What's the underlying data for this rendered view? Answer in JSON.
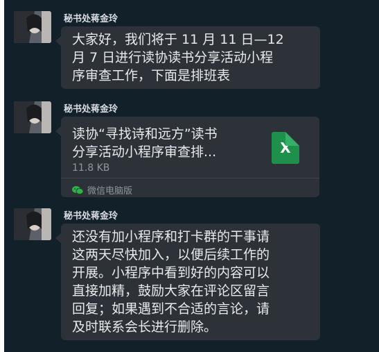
{
  "messages": [
    {
      "sender": "秘书处蒋金玲",
      "type": "text",
      "lines": [
        "大家好，我们将于 11 月 11 日—12",
        "月 7 日进行读协读书分享活动小程",
        "序审查工作，下面是排班表"
      ]
    },
    {
      "sender": "秘书处蒋金玲",
      "type": "file",
      "file_name_lines": [
        "读协“寻找诗和远方”读书",
        "分享活动小程序审查排..."
      ],
      "file_size": "11.8 KB",
      "file_icon_letter": "X",
      "source": "微信电脑版",
      "file_icon": "excel-file-icon"
    },
    {
      "sender": "秘书处蒋金玲",
      "type": "text",
      "lines": [
        "还没有加小程序和打卡群的干事请",
        "这两天尽快加入，以便后续工作的",
        "开展。小程序中看到好的内容可以",
        "直接加精，鼓励大家在评论区留言",
        "回复；如果遇到不合适的言论，请",
        "及时联系会长进行删除。"
      ]
    }
  ],
  "colors": {
    "background": "#12202a",
    "bubble": "#2c3238",
    "excel_green": "#1f8f4c"
  }
}
